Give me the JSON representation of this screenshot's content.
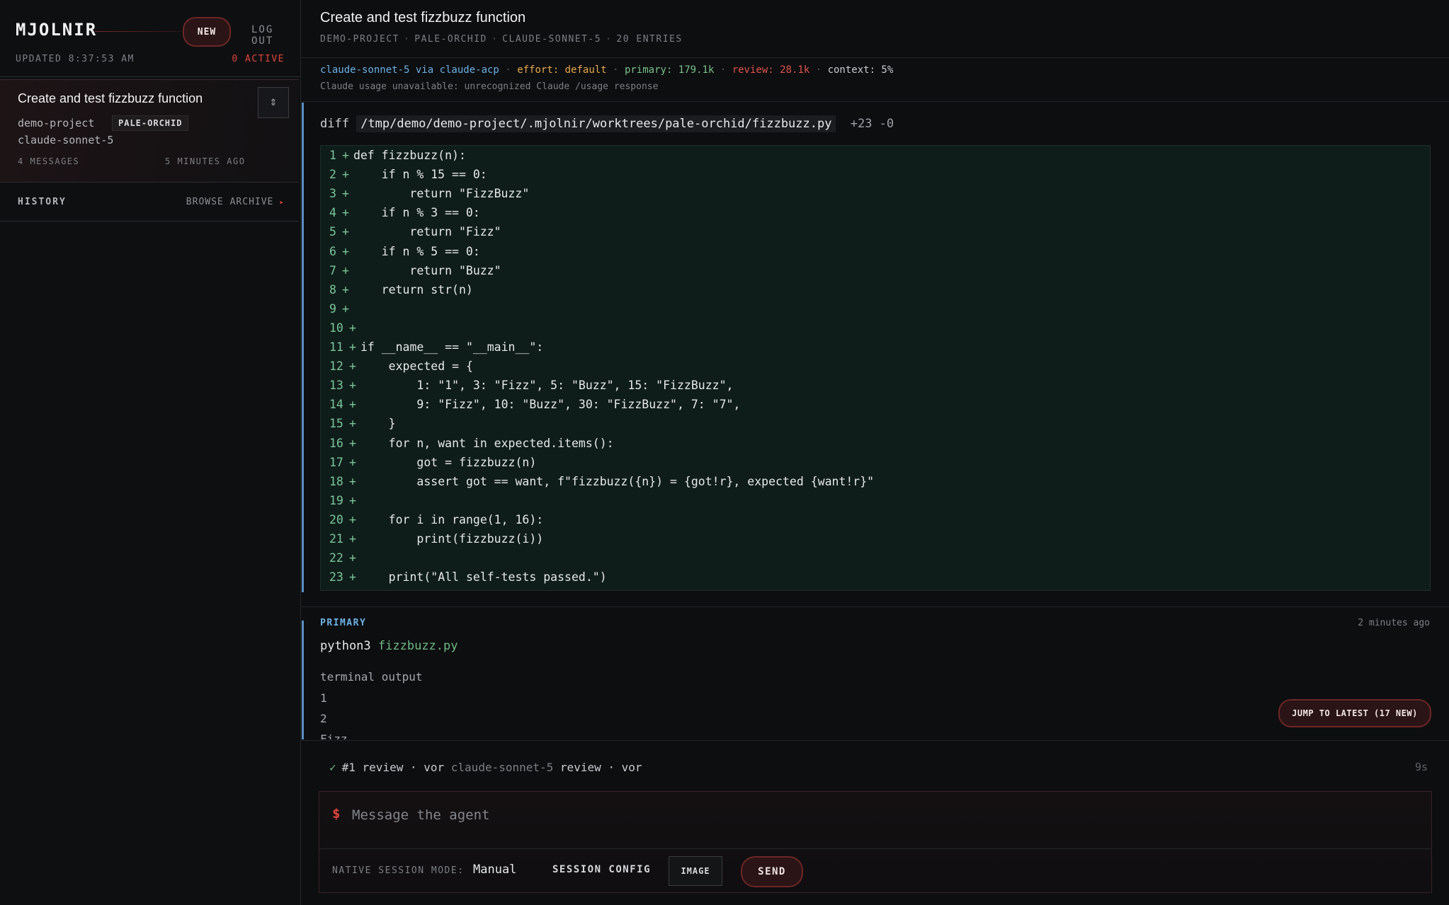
{
  "sidebar": {
    "brand": "MJOLNIR",
    "new_label": "NEW",
    "logout_label": "LOG OUT",
    "updated": "UPDATED 8:37:53 AM",
    "active": "0 ACTIVE",
    "session": {
      "title": "Create and test fizzbuzz function",
      "collapse_icon": "⇕",
      "project": "demo-project",
      "tag": "PALE-ORCHID",
      "model": "claude-sonnet-5",
      "messages": "4 MESSAGES",
      "time": "5 MINUTES AGO"
    },
    "history_label": "HISTORY",
    "browse_label": "BROWSE ARCHIVE",
    "browse_arrow": "▸"
  },
  "header": {
    "title": "Create and test fizzbuzz function",
    "crumbs": [
      "DEMO-PROJECT",
      "PALE-ORCHID",
      "CLAUDE-SONNET-5",
      "20 ENTRIES"
    ],
    "separator": "·"
  },
  "meta": {
    "agent": "claude-sonnet-5 via claude-acp",
    "effort": "effort: default",
    "primary": "primary: 179.1k",
    "review": "review: 28.1k",
    "context": "context: 5%",
    "usage_note": "Claude usage unavailable: unrecognized Claude /usage response"
  },
  "diff": {
    "prefix": "diff",
    "path": "/tmp/demo/demo-project/.mjolnir/worktrees/pale-orchid/fizzbuzz.py",
    "stats": "+23 -0",
    "lines": [
      {
        "n": "1",
        "code": "def fizzbuzz(n):"
      },
      {
        "n": "2",
        "code": "    if n % 15 == 0:"
      },
      {
        "n": "3",
        "code": "        return \"FizzBuzz\""
      },
      {
        "n": "4",
        "code": "    if n % 3 == 0:"
      },
      {
        "n": "5",
        "code": "        return \"Fizz\""
      },
      {
        "n": "6",
        "code": "    if n % 5 == 0:"
      },
      {
        "n": "7",
        "code": "        return \"Buzz\""
      },
      {
        "n": "8",
        "code": "    return str(n)"
      },
      {
        "n": "9",
        "code": ""
      },
      {
        "n": "10",
        "code": ""
      },
      {
        "n": "11",
        "code": "if __name__ == \"__main__\":"
      },
      {
        "n": "12",
        "code": "    expected = {"
      },
      {
        "n": "13",
        "code": "        1: \"1\", 3: \"Fizz\", 5: \"Buzz\", 15: \"FizzBuzz\","
      },
      {
        "n": "14",
        "code": "        9: \"Fizz\", 10: \"Buzz\", 30: \"FizzBuzz\", 7: \"7\","
      },
      {
        "n": "15",
        "code": "    }"
      },
      {
        "n": "16",
        "code": "    for n, want in expected.items():"
      },
      {
        "n": "17",
        "code": "        got = fizzbuzz(n)"
      },
      {
        "n": "18",
        "code": "        assert got == want, f\"fizzbuzz({n}) = {got!r}, expected {want!r}\""
      },
      {
        "n": "19",
        "code": ""
      },
      {
        "n": "20",
        "code": "    for i in range(1, 16):"
      },
      {
        "n": "21",
        "code": "        print(fizzbuzz(i))"
      },
      {
        "n": "22",
        "code": ""
      },
      {
        "n": "23",
        "code": "    print(\"All self-tests passed.\")"
      }
    ]
  },
  "entry": {
    "label": "PRIMARY",
    "time": "2 minutes ago",
    "cmd": "python3",
    "cmd_arg": "fizzbuzz.py",
    "terminal_label": "terminal output",
    "terminal_lines": [
      "1",
      "2",
      "Fizz"
    ]
  },
  "jump_label": "JUMP TO LATEST (17 NEW)",
  "status": {
    "check": "✓",
    "text": "#1 review · vor",
    "detail": "claude-sonnet-5",
    "tail": "review · vor",
    "elapsed": "9s"
  },
  "composer": {
    "prompt_sign": "$",
    "placeholder": "Message the agent",
    "mode_label": "NATIVE SESSION MODE:",
    "mode_value": "Manual",
    "session_config": "SESSION CONFIG",
    "image_label": "IMAGE",
    "send_label": "SEND"
  }
}
